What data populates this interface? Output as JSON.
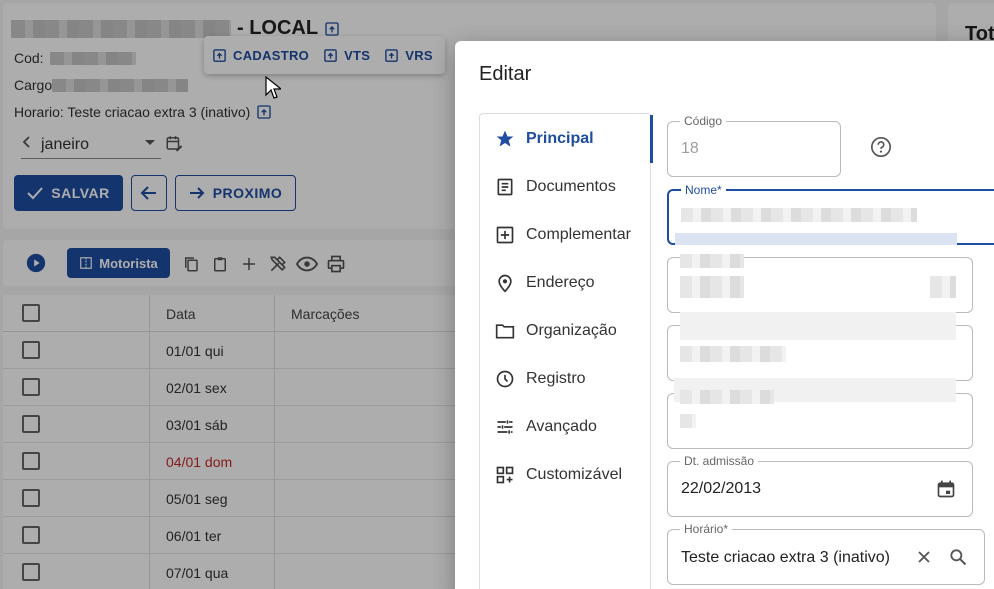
{
  "background": {
    "title_suffix": "- LOCAL",
    "cod_label": "Cod:",
    "cargo_label": "Cargo",
    "horario_line": "Horario: Teste criacao extra 3 (inativo)",
    "month": "janeiro",
    "btn_salvar": "SALVAR",
    "btn_proximo": "PROXIMO",
    "dropdown": [
      "CADASTRO",
      "VTS",
      "VRS"
    ],
    "tot_label": "Tot",
    "btn_motorista": "Motorista",
    "table": {
      "headers": [
        "Data",
        "Marcações"
      ],
      "rows": [
        {
          "date": "01/01 qui",
          "color": "#333333"
        },
        {
          "date": "02/01 sex",
          "color": "#333333"
        },
        {
          "date": "03/01 sáb",
          "color": "#333333"
        },
        {
          "date": "04/01 dom",
          "color": "#c62828"
        },
        {
          "date": "05/01 seg",
          "color": "#333333"
        },
        {
          "date": "06/01 ter",
          "color": "#333333"
        },
        {
          "date": "07/01 qua",
          "color": "#333333"
        }
      ]
    }
  },
  "modal": {
    "title": "Editar",
    "nav": [
      {
        "label": "Principal",
        "icon": "star-icon",
        "active": true
      },
      {
        "label": "Documentos",
        "icon": "document-icon",
        "active": false
      },
      {
        "label": "Complementar",
        "icon": "plus-box-icon",
        "active": false
      },
      {
        "label": "Endereço",
        "icon": "location-pin-icon",
        "active": false
      },
      {
        "label": "Organização",
        "icon": "folder-icon",
        "active": false
      },
      {
        "label": "Registro",
        "icon": "clock-icon",
        "active": false
      },
      {
        "label": "Avançado",
        "icon": "tune-icon",
        "active": false
      },
      {
        "label": "Customizável",
        "icon": "widgets-icon",
        "active": false
      }
    ],
    "fields": {
      "codigo": {
        "label": "Código",
        "value": "18"
      },
      "nome": {
        "label": "Nome*"
      },
      "admissao": {
        "label": "Dt. admissão",
        "value": "22/02/2013"
      },
      "horario": {
        "label": "Horário*",
        "value": "Teste criacao extra 3 (inativo)"
      }
    }
  },
  "colors": {
    "primary": "#1e4da1",
    "weekend": "#c62828"
  }
}
